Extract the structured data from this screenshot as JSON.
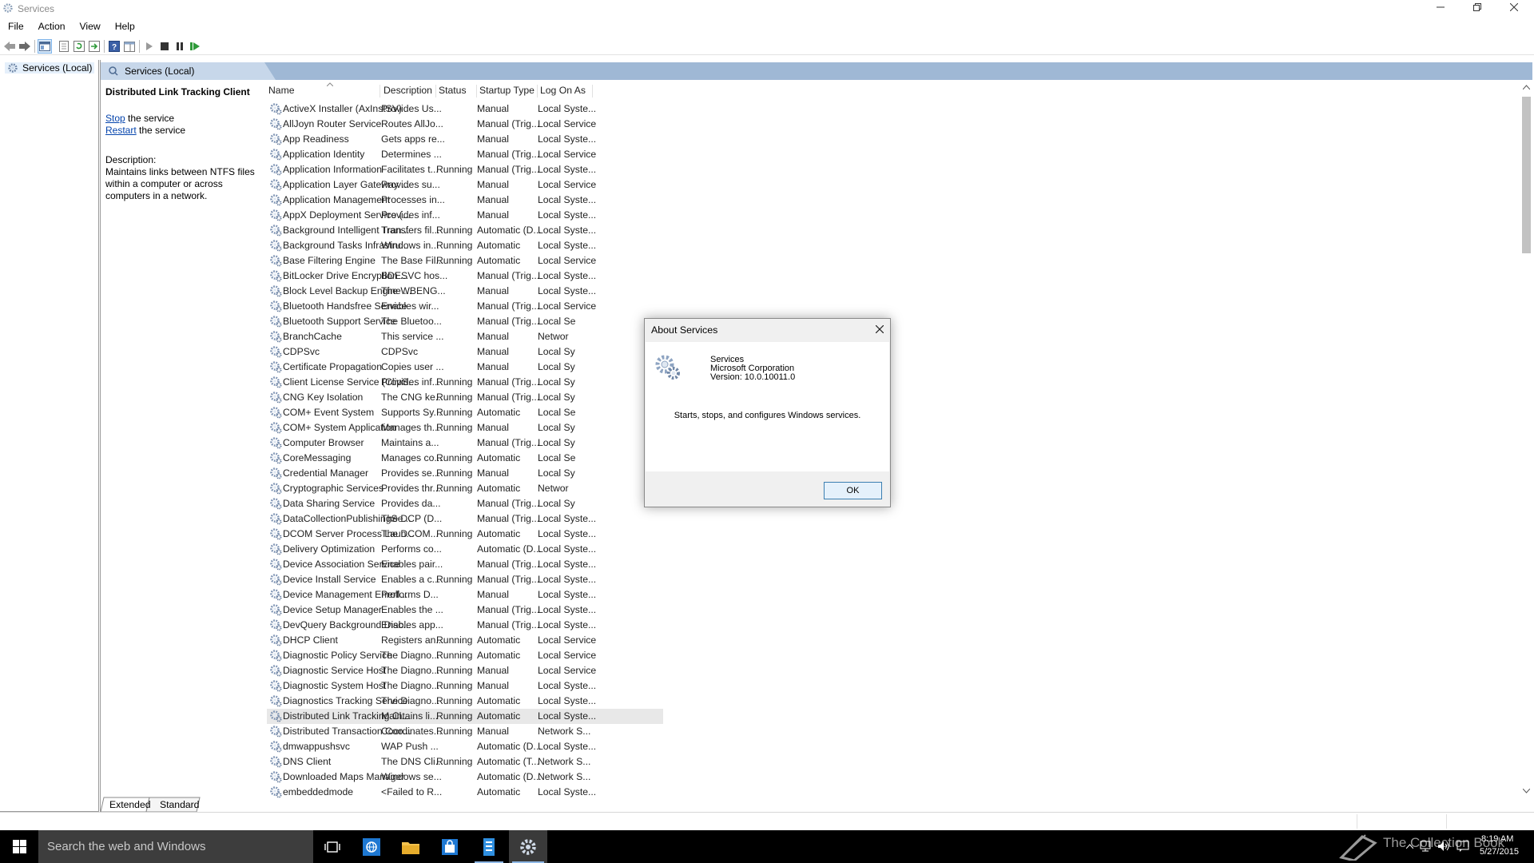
{
  "window": {
    "title": "Services",
    "controls": {
      "minimize": "—",
      "maximize": "❐",
      "close": "✕"
    }
  },
  "menu": [
    "File",
    "Action",
    "View",
    "Help"
  ],
  "tree": {
    "label": "Services (Local)"
  },
  "pane_header": {
    "label": "Services (Local)"
  },
  "selected_service": {
    "title": "Distributed Link Tracking Client",
    "stop_link": "Stop",
    "stop_suffix": " the service",
    "restart_link": "Restart",
    "restart_suffix": " the service",
    "description_label": "Description:",
    "description": "Maintains links between NTFS files within a computer or across computers in a network."
  },
  "columns": [
    "Name",
    "Description",
    "Status",
    "Startup Type",
    "Log On As"
  ],
  "rows": [
    {
      "name": "ActiveX Installer (AxInstSV)",
      "desc": "Provides Us...",
      "status": "",
      "startup": "Manual",
      "logon": "Local Syste..."
    },
    {
      "name": "AllJoyn Router Service",
      "desc": "Routes AllJo...",
      "status": "",
      "startup": "Manual (Trig...",
      "logon": "Local Service"
    },
    {
      "name": "App Readiness",
      "desc": "Gets apps re...",
      "status": "",
      "startup": "Manual",
      "logon": "Local Syste..."
    },
    {
      "name": "Application Identity",
      "desc": "Determines ...",
      "status": "",
      "startup": "Manual (Trig...",
      "logon": "Local Service"
    },
    {
      "name": "Application Information",
      "desc": "Facilitates t...",
      "status": "Running",
      "startup": "Manual (Trig...",
      "logon": "Local Syste..."
    },
    {
      "name": "Application Layer Gateway ...",
      "desc": "Provides su...",
      "status": "",
      "startup": "Manual",
      "logon": "Local Service"
    },
    {
      "name": "Application Management",
      "desc": "Processes in...",
      "status": "",
      "startup": "Manual",
      "logon": "Local Syste..."
    },
    {
      "name": "AppX Deployment Service (...",
      "desc": "Provides inf...",
      "status": "",
      "startup": "Manual",
      "logon": "Local Syste..."
    },
    {
      "name": "Background Intelligent Tran...",
      "desc": "Transfers fil...",
      "status": "Running",
      "startup": "Automatic (D...",
      "logon": "Local Syste..."
    },
    {
      "name": "Background Tasks Infrastru...",
      "desc": "Windows in...",
      "status": "Running",
      "startup": "Automatic",
      "logon": "Local Syste..."
    },
    {
      "name": "Base Filtering Engine",
      "desc": "The Base Fil...",
      "status": "Running",
      "startup": "Automatic",
      "logon": "Local Service"
    },
    {
      "name": "BitLocker Drive Encryption ...",
      "desc": "BDESVC hos...",
      "status": "",
      "startup": "Manual (Trig...",
      "logon": "Local Syste..."
    },
    {
      "name": "Block Level Backup Engine ...",
      "desc": "The WBENG...",
      "status": "",
      "startup": "Manual",
      "logon": "Local Syste..."
    },
    {
      "name": "Bluetooth Handsfree Service",
      "desc": "Enables wir...",
      "status": "",
      "startup": "Manual (Trig...",
      "logon": "Local Service"
    },
    {
      "name": "Bluetooth Support Service",
      "desc": "The Bluetoo...",
      "status": "",
      "startup": "Manual (Trig...",
      "logon": "Local Se"
    },
    {
      "name": "BranchCache",
      "desc": "This service ...",
      "status": "",
      "startup": "Manual",
      "logon": "Networ"
    },
    {
      "name": "CDPSvc",
      "desc": "CDPSvc",
      "status": "",
      "startup": "Manual",
      "logon": "Local Sy"
    },
    {
      "name": "Certificate Propagation",
      "desc": "Copies user ...",
      "status": "",
      "startup": "Manual",
      "logon": "Local Sy"
    },
    {
      "name": "Client License Service (ClipS...",
      "desc": "Provides inf...",
      "status": "Running",
      "startup": "Manual (Trig...",
      "logon": "Local Sy"
    },
    {
      "name": "CNG Key Isolation",
      "desc": "The CNG ke...",
      "status": "Running",
      "startup": "Manual (Trig...",
      "logon": "Local Sy"
    },
    {
      "name": "COM+ Event System",
      "desc": "Supports Sy...",
      "status": "Running",
      "startup": "Automatic",
      "logon": "Local Se"
    },
    {
      "name": "COM+ System Application",
      "desc": "Manages th...",
      "status": "Running",
      "startup": "Manual",
      "logon": "Local Sy"
    },
    {
      "name": "Computer Browser",
      "desc": "Maintains a...",
      "status": "",
      "startup": "Manual (Trig...",
      "logon": "Local Sy"
    },
    {
      "name": "CoreMessaging",
      "desc": "Manages co...",
      "status": "Running",
      "startup": "Automatic",
      "logon": "Local Se"
    },
    {
      "name": "Credential Manager",
      "desc": "Provides se...",
      "status": "Running",
      "startup": "Manual",
      "logon": "Local Sy"
    },
    {
      "name": "Cryptographic Services",
      "desc": "Provides thr...",
      "status": "Running",
      "startup": "Automatic",
      "logon": "Networ"
    },
    {
      "name": "Data Sharing Service",
      "desc": "Provides da...",
      "status": "",
      "startup": "Manual (Trig...",
      "logon": "Local Sy"
    },
    {
      "name": "DataCollectionPublishingSe...",
      "desc": "The DCP (D...",
      "status": "",
      "startup": "Manual (Trig...",
      "logon": "Local Syste..."
    },
    {
      "name": "DCOM Server Process Laun...",
      "desc": "The DCOM...",
      "status": "Running",
      "startup": "Automatic",
      "logon": "Local Syste..."
    },
    {
      "name": "Delivery Optimization",
      "desc": "Performs co...",
      "status": "",
      "startup": "Automatic (D...",
      "logon": "Local Syste..."
    },
    {
      "name": "Device Association Service",
      "desc": "Enables pair...",
      "status": "",
      "startup": "Manual (Trig...",
      "logon": "Local Syste..."
    },
    {
      "name": "Device Install Service",
      "desc": "Enables a c...",
      "status": "Running",
      "startup": "Manual (Trig...",
      "logon": "Local Syste..."
    },
    {
      "name": "Device Management Enroll...",
      "desc": "Performs D...",
      "status": "",
      "startup": "Manual",
      "logon": "Local Syste..."
    },
    {
      "name": "Device Setup Manager",
      "desc": "Enables the ...",
      "status": "",
      "startup": "Manual (Trig...",
      "logon": "Local Syste..."
    },
    {
      "name": "DevQuery Background Disc...",
      "desc": "Enables app...",
      "status": "",
      "startup": "Manual (Trig...",
      "logon": "Local Syste..."
    },
    {
      "name": "DHCP Client",
      "desc": "Registers an...",
      "status": "Running",
      "startup": "Automatic",
      "logon": "Local Service"
    },
    {
      "name": "Diagnostic Policy Service",
      "desc": "The Diagno...",
      "status": "Running",
      "startup": "Automatic",
      "logon": "Local Service"
    },
    {
      "name": "Diagnostic Service Host",
      "desc": "The Diagno...",
      "status": "Running",
      "startup": "Manual",
      "logon": "Local Service"
    },
    {
      "name": "Diagnostic System Host",
      "desc": "The Diagno...",
      "status": "Running",
      "startup": "Manual",
      "logon": "Local Syste..."
    },
    {
      "name": "Diagnostics Tracking Service",
      "desc": "The Diagno...",
      "status": "Running",
      "startup": "Automatic",
      "logon": "Local Syste..."
    },
    {
      "name": "Distributed Link Tracking Cl...",
      "desc": "Maintains li...",
      "status": "Running",
      "startup": "Automatic",
      "logon": "Local Syste...",
      "selected": true
    },
    {
      "name": "Distributed Transaction Coo...",
      "desc": "Coordinates...",
      "status": "Running",
      "startup": "Manual",
      "logon": "Network S..."
    },
    {
      "name": "dmwappushsvc",
      "desc": "WAP Push ...",
      "status": "",
      "startup": "Automatic (D...",
      "logon": "Local Syste..."
    },
    {
      "name": "DNS Client",
      "desc": "The DNS Cli...",
      "status": "Running",
      "startup": "Automatic (T...",
      "logon": "Network S..."
    },
    {
      "name": "Downloaded Maps Manager",
      "desc": "Windows se...",
      "status": "",
      "startup": "Automatic (D...",
      "logon": "Network S..."
    },
    {
      "name": "embeddedmode",
      "desc": "<Failed to R...",
      "status": "",
      "startup": "Automatic",
      "logon": "Local Syste..."
    }
  ],
  "tabs": [
    "Extended",
    "Standard"
  ],
  "dialog": {
    "title": "About Services",
    "product": "Services",
    "company": "Microsoft Corporation",
    "version": "Version: 10.0.10011.0",
    "message": "Starts, stops, and configures Windows services.",
    "ok": "OK"
  },
  "taskbar": {
    "search_placeholder": "Search the web and Windows",
    "time": "8:19 AM",
    "date": "5/27/2015",
    "watermark": "The Collection Book"
  },
  "colors": {
    "header_blue": "#9fb8d5",
    "selection": "#e8e8e8",
    "taskbar": "#000000",
    "link": "#0645ad"
  }
}
